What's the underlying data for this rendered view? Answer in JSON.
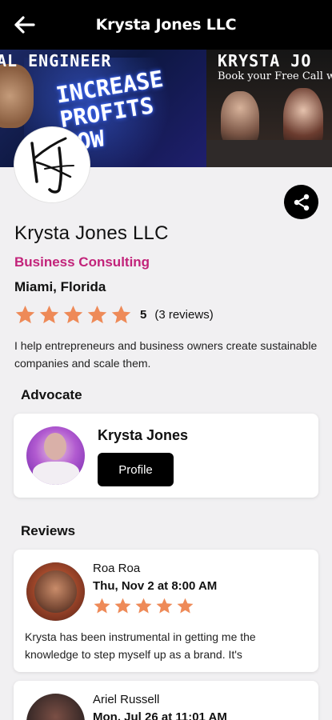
{
  "header": {
    "title": "Krysta Jones LLC",
    "back_icon": "arrow-left-icon"
  },
  "banner": {
    "left_top_text": "AL ENGINEER",
    "left_slogan": "INCREASE\nPROFITS\nNOW",
    "right_name": "KRYSTA JO",
    "right_call": "Book your Free Call w"
  },
  "business": {
    "name": "Krysta Jones LLC",
    "category": "Business Consulting",
    "location": "Miami, Florida",
    "rating": "5",
    "reviews_count": "(3 reviews)",
    "rating_stars": 5,
    "description": "I help entrepreneurs  and business owners create sustainable  companies and scale them."
  },
  "advocate": {
    "section_title": "Advocate",
    "name": "Krysta Jones",
    "profile_label": "Profile"
  },
  "reviews": {
    "section_title": "Reviews",
    "items": [
      {
        "name": "Roa Roa",
        "date": "Thu, Nov 2 at 8:00 AM",
        "stars": 5,
        "text": "Krysta has been instrumental in getting me the knowledge to step myself up as a brand. It's"
      },
      {
        "name": "Ariel Russell",
        "date": "Mon, Jul 26 at 11:01 AM"
      }
    ]
  },
  "colors": {
    "accent_pink": "#c2237a",
    "star_orange": "#ee8a58",
    "header_bg": "#000000"
  }
}
